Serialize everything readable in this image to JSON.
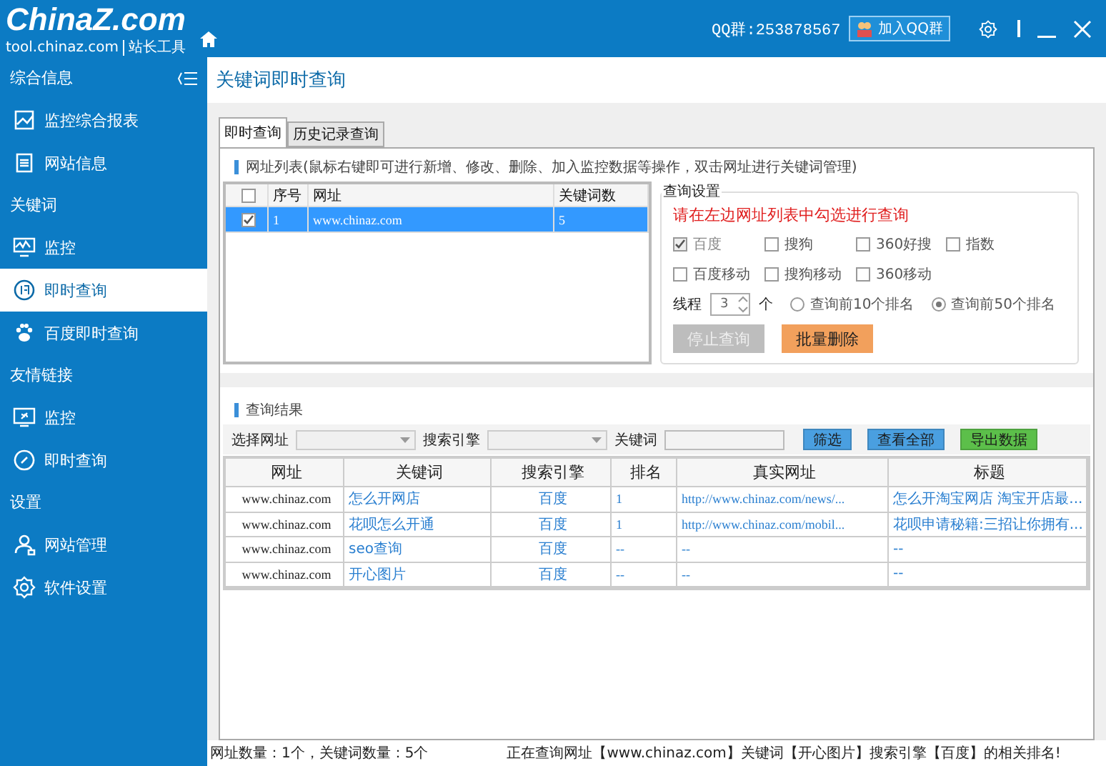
{
  "header": {
    "logo": "ChinaZ.com",
    "domain": "tool.chinaz.com",
    "tagline": "站长工具",
    "qq_group": "QQ群:253878567",
    "join_button": "加入QQ群"
  },
  "sidebar": {
    "sections": [
      {
        "title": "综合信息",
        "items": [
          {
            "label": "监控综合报表",
            "selected": false
          },
          {
            "label": "网站信息",
            "selected": false
          }
        ]
      },
      {
        "title": "关键词",
        "items": [
          {
            "label": "监控",
            "selected": false
          },
          {
            "label": "即时查询",
            "selected": true
          },
          {
            "label": "百度即时查询",
            "selected": false
          }
        ]
      },
      {
        "title": "友情链接",
        "items": [
          {
            "label": "监控",
            "selected": false
          },
          {
            "label": "即时查询",
            "selected": false
          }
        ]
      },
      {
        "title": "设置",
        "items": [
          {
            "label": "网站管理",
            "selected": false
          },
          {
            "label": "软件设置",
            "selected": false
          }
        ]
      }
    ]
  },
  "page_title": "关键词即时查询",
  "tabs": [
    {
      "label": "即时查询",
      "selected": true
    },
    {
      "label": "历史记录查询",
      "selected": false
    }
  ],
  "url_list": {
    "heading": "网址列表(鼠标右键即可进行新增、修改、删除、加入监控数据等操作，双击网址进行关键词管理)",
    "header_checked": false,
    "columns": [
      "序号",
      "网址",
      "关键词数"
    ],
    "rows": [
      {
        "checked": true,
        "selected": true,
        "cells": [
          "1",
          "www.chinaz.com",
          "5"
        ]
      }
    ]
  },
  "query_settings": {
    "title": "查询设置",
    "hint": "请在左边网址列表中勾选进行查询",
    "engines": [
      {
        "label": "百度",
        "checked": true,
        "disabled": true
      },
      {
        "label": "搜狗",
        "checked": false,
        "disabled": false
      },
      {
        "label": "360好搜",
        "checked": false,
        "disabled": false
      },
      {
        "label": "指数",
        "checked": false,
        "disabled": false
      },
      {
        "label": "百度移动",
        "checked": false,
        "disabled": false
      },
      {
        "label": "搜狗移动",
        "checked": false,
        "disabled": false
      },
      {
        "label": "360移动",
        "checked": false,
        "disabled": false
      }
    ],
    "thread_label": "线程",
    "thread_value": "3",
    "thread_unit": "个",
    "radios": [
      {
        "label": "查询前10个排名",
        "selected": false
      },
      {
        "label": "查询前50个排名",
        "selected": true
      }
    ],
    "buttons": [
      {
        "label": "停止查询",
        "disabled": true
      },
      {
        "label": "批量删除",
        "disabled": false
      }
    ]
  },
  "results": {
    "heading": "查询结果",
    "filters": [
      {
        "label": "选择网址",
        "kind": "select"
      },
      {
        "label": "搜索引擎",
        "kind": "select"
      },
      {
        "label": "关键词",
        "kind": "input"
      }
    ],
    "buttons": [
      {
        "label": "筛选",
        "color": "#4a9fe0"
      },
      {
        "label": "查看全部",
        "color": "#4a9fe0"
      },
      {
        "label": "导出数据",
        "color": "#5cbf4a"
      }
    ],
    "columns": [
      "网址",
      "关键词",
      "搜索引擎",
      "排名",
      "真实网址",
      "标题"
    ],
    "rows": [
      {
        "cells": [
          "www.chinaz.com",
          "怎么开网店",
          "百度",
          "1",
          "http://www.chinaz.com/news/...",
          "怎么开淘宝网店 淘宝开店最..."
        ]
      },
      {
        "cells": [
          "www.chinaz.com",
          "花呗怎么开通",
          "百度",
          "1",
          "http://www.chinaz.com/mobil...",
          "花呗申请秘籍:三招让你拥有..."
        ]
      },
      {
        "cells": [
          "www.chinaz.com",
          "seo查询",
          "百度",
          "--",
          "--",
          "--"
        ]
      },
      {
        "cells": [
          "www.chinaz.com",
          "开心图片",
          "百度",
          "--",
          "--",
          "--"
        ]
      }
    ]
  },
  "status_bar": {
    "counts": "网址数量：1个，关键词数量：5个",
    "message": "正在查询网址【www.chinaz.com】关键词【开心图片】搜索引擎【百度】的相关排名!"
  }
}
